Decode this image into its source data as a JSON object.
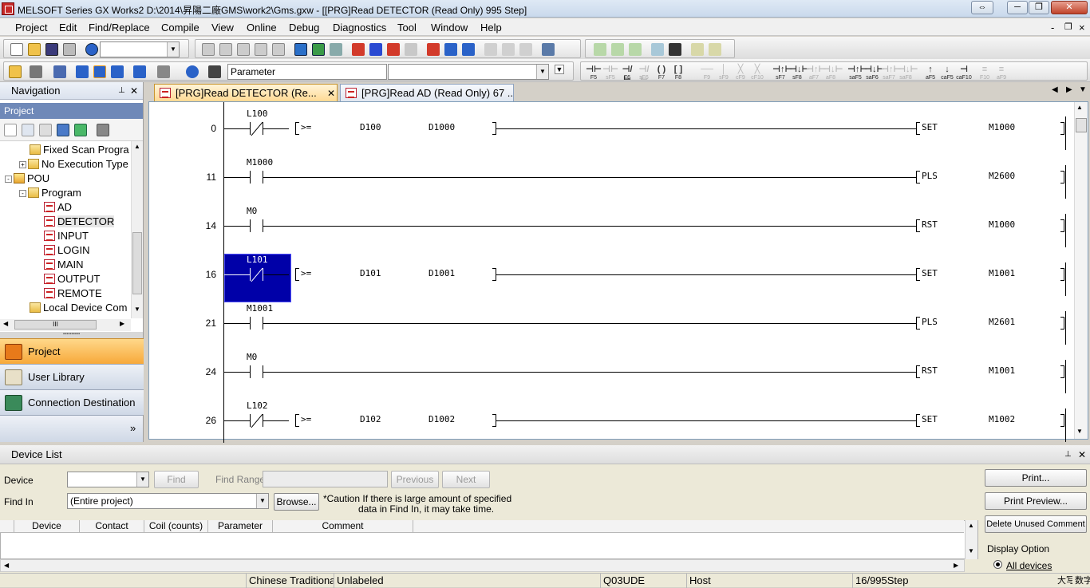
{
  "window": {
    "title": "MELSOFT Series GX Works2 D:\\2014\\昇陽二廠GMS\\work2\\Gms.gxw - [[PRG]Read DETECTOR (Read Only) 995 Step]",
    "restore_glyph": "⇔",
    "minimize_glyph": "─",
    "maximize_glyph": "❐",
    "close_glyph": "✕"
  },
  "menu": {
    "items": [
      "Project",
      "Edit",
      "Find/Replace",
      "Compile",
      "View",
      "Online",
      "Debug",
      "Diagnostics",
      "Tool",
      "Window",
      "Help"
    ],
    "mdi_min": "-",
    "mdi_restore": "❐",
    "mdi_close": "×"
  },
  "toolbar": {
    "parameter_combo": "Parameter",
    "fkeys": [
      {
        "sym": "⊣⊢",
        "label": "F5",
        "on": true
      },
      {
        "sym": "⊣⊢",
        "label": "sF5",
        "on": false
      },
      {
        "sym": "⊣/⊢",
        "label": "F6",
        "on": true
      },
      {
        "sym": "⊣/⊢",
        "label": "sF6",
        "on": false
      },
      {
        "sym": "( )",
        "label": "F7",
        "on": true
      },
      {
        "sym": "[ ]",
        "label": "F8",
        "on": true
      },
      {
        "sym": "──",
        "label": "F9",
        "on": false
      },
      {
        "sym": "│",
        "label": "sF9",
        "on": false
      },
      {
        "sym": "╳",
        "label": "cF9",
        "on": false
      },
      {
        "sym": "╳",
        "label": "cF10",
        "on": false
      },
      {
        "sym": "⊣↑⊢",
        "label": "sF7",
        "on": true
      },
      {
        "sym": "⊣↓⊢",
        "label": "sF8",
        "on": true
      },
      {
        "sym": "⊣↑⊢",
        "label": "aF7",
        "on": false
      },
      {
        "sym": "⊣↓⊢",
        "label": "aF8",
        "on": false
      },
      {
        "sym": "⊣↑⊢",
        "label": "saF5",
        "on": true
      },
      {
        "sym": "⊣↓⊢",
        "label": "saF6",
        "on": true
      },
      {
        "sym": "⊣↑⊢",
        "label": "saF7",
        "on": false
      },
      {
        "sym": "⊣↓⊢",
        "label": "saF8",
        "on": false
      },
      {
        "sym": "↑",
        "label": "aF5",
        "on": true
      },
      {
        "sym": "↓",
        "label": "caF5",
        "on": true
      },
      {
        "sym": "⊣",
        "label": "caF10",
        "on": true
      },
      {
        "sym": "≡",
        "label": "F10",
        "on": false
      },
      {
        "sym": "≡",
        "label": "aF9",
        "on": false
      }
    ]
  },
  "navigation": {
    "title": "Navigation",
    "pin": "📌",
    "close": "✕",
    "section": "Project",
    "tree": [
      {
        "label": "Fixed Scan Progra",
        "indent": 1,
        "icon": "folder-prog",
        "expander": ""
      },
      {
        "label": "No Execution Type",
        "indent": 1,
        "icon": "folder-prog",
        "expander": "+"
      },
      {
        "label": "POU",
        "indent": 0,
        "icon": "pou",
        "expander": "-"
      },
      {
        "label": "Program",
        "indent": 1,
        "icon": "folder",
        "expander": "-"
      },
      {
        "label": "AD",
        "indent": 2,
        "icon": "prog",
        "expander": ""
      },
      {
        "label": "DETECTOR",
        "indent": 2,
        "icon": "prog",
        "expander": ""
      },
      {
        "label": "INPUT",
        "indent": 2,
        "icon": "prog",
        "expander": ""
      },
      {
        "label": "LOGIN",
        "indent": 2,
        "icon": "prog",
        "expander": ""
      },
      {
        "label": "MAIN",
        "indent": 2,
        "icon": "prog",
        "expander": ""
      },
      {
        "label": "OUTPUT",
        "indent": 2,
        "icon": "prog",
        "expander": ""
      },
      {
        "label": "REMOTE",
        "indent": 2,
        "icon": "prog",
        "expander": ""
      },
      {
        "label": "Local Device Com",
        "indent": 1,
        "icon": "folder",
        "expander": ""
      }
    ],
    "hscroll_mid": "III",
    "buttons": [
      "Project",
      "User Library",
      "Connection Destination"
    ],
    "more": "»"
  },
  "editor": {
    "tabs": [
      {
        "label": "[PRG]Read DETECTOR (Re...",
        "active": true
      },
      {
        "label": "[PRG]Read AD (Read Only) 67 ...",
        "active": false
      }
    ],
    "tab_close": "✕",
    "rungs": [
      {
        "step": "0",
        "contact": "L100",
        "type": "nc",
        "compare": {
          "op": ">=",
          "a": "D100",
          "b": "D1000"
        },
        "instr": "SET",
        "operand": "M1000",
        "selected": false
      },
      {
        "step": "11",
        "contact": "M1000",
        "type": "no",
        "compare": null,
        "instr": "PLS",
        "operand": "M2600",
        "selected": false
      },
      {
        "step": "14",
        "contact": "M0",
        "type": "no",
        "compare": null,
        "instr": "RST",
        "operand": "M1000",
        "selected": false
      },
      {
        "step": "16",
        "contact": "L101",
        "type": "nc",
        "compare": {
          "op": ">=",
          "a": "D101",
          "b": "D1001"
        },
        "instr": "SET",
        "operand": "M1001",
        "selected": true
      },
      {
        "step": "21",
        "contact": "M1001",
        "type": "no",
        "compare": null,
        "instr": "PLS",
        "operand": "M2601",
        "selected": false
      },
      {
        "step": "24",
        "contact": "M0",
        "type": "no",
        "compare": null,
        "instr": "RST",
        "operand": "M1001",
        "selected": false
      },
      {
        "step": "26",
        "contact": "L102",
        "type": "nc",
        "compare": {
          "op": ">=",
          "a": "D102",
          "b": "D1002"
        },
        "instr": "SET",
        "operand": "M1002",
        "selected": false
      }
    ]
  },
  "device_list": {
    "title": "Device List",
    "device_label": "Device",
    "device_value": "",
    "find_button": "Find",
    "find_range_label": "Find Range",
    "find_range_value": "",
    "previous_button": "Previous",
    "next_button": "Next",
    "find_in_label": "Find In",
    "find_in_value": "(Entire project)",
    "browse_button": "Browse...",
    "caution_line1": "*Caution If there is large amount of specified",
    "caution_line2": "data in Find In, it may take time.",
    "columns": [
      "Device",
      "Contact",
      "Coil (counts)",
      "Parameter",
      "Comment"
    ],
    "print_button": "Print...",
    "print_preview_button": "Print Preview...",
    "delete_button": "Delete Unused Comment",
    "display_option_label": "Display Option",
    "all_devices_label": "All devices"
  },
  "status": {
    "language": "Chinese Traditiona",
    "label_state": "Unlabeled",
    "cpu": "Q03UDE",
    "connection": "Host",
    "step": "16/995Step",
    "ime1": "大写",
    "ime2": "数字"
  }
}
